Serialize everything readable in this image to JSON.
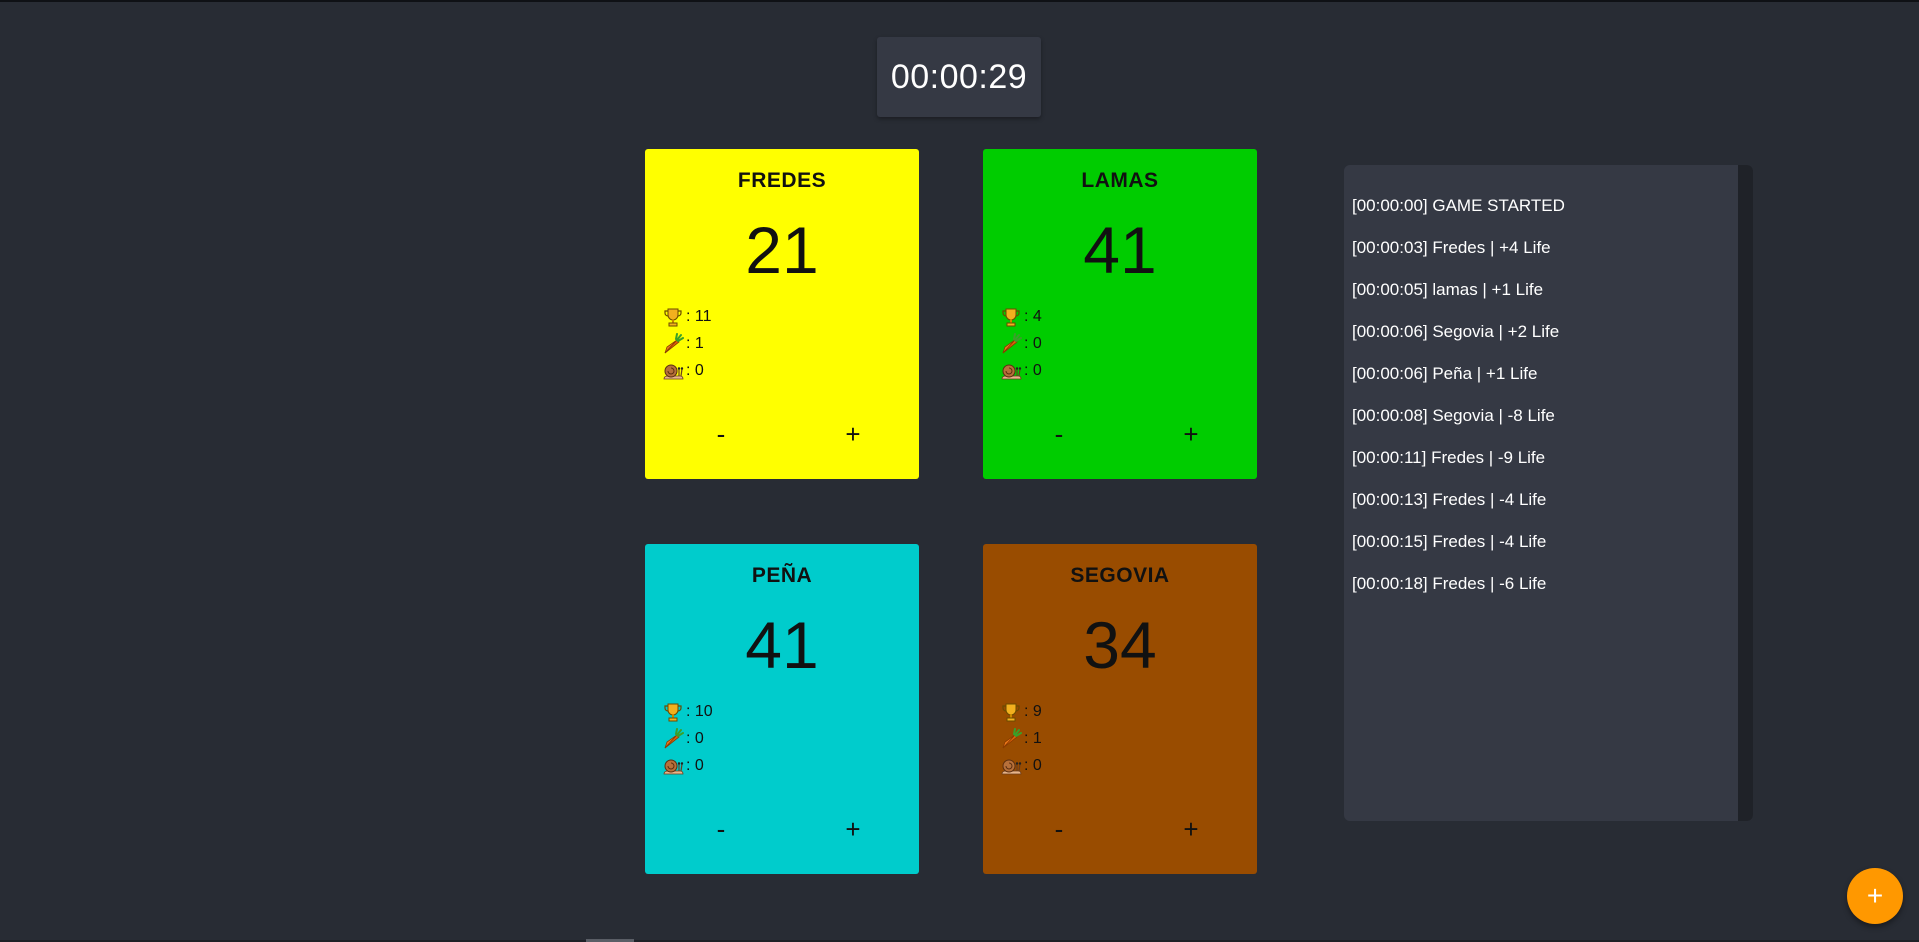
{
  "timer": "00:00:29",
  "players": [
    {
      "name": "FREDES",
      "life": "21",
      "color": "#ffff00",
      "stats": {
        "trophy": ": 11",
        "carrot": ": 1",
        "snail": ": 0"
      }
    },
    {
      "name": "LAMAS",
      "life": "41",
      "color": "#00cc00",
      "stats": {
        "trophy": ": 4",
        "carrot": ": 0",
        "snail": ": 0"
      }
    },
    {
      "name": "PEÑA",
      "life": "41",
      "color": "#00cccc",
      "stats": {
        "trophy": ": 10",
        "carrot": ": 0",
        "snail": ": 0"
      }
    },
    {
      "name": "SEGOVIA",
      "life": "34",
      "color": "#994c00",
      "stats": {
        "trophy": ": 9",
        "carrot": ": 1",
        "snail": ": 0"
      }
    }
  ],
  "buttons": {
    "minus": "-",
    "plus": "+"
  },
  "icons": {
    "trophy": "trophy-icon",
    "carrot": "carrot-icon",
    "snail": "snail-icon",
    "fab": "plus-icon"
  },
  "log": [
    "[00:00:00] GAME STARTED",
    "[00:00:03] Fredes | +4 Life",
    "[00:00:05] lamas | +1 Life",
    "[00:00:06] Segovia | +2 Life",
    "[00:00:06] Peña | +1 Life",
    "[00:00:08] Segovia | -8 Life",
    "[00:00:11] Fredes | -9 Life",
    "[00:00:13] Fredes | -4 Life",
    "[00:00:15] Fredes | -4 Life",
    "[00:00:18] Fredes | -6 Life"
  ],
  "fab_label": "+"
}
